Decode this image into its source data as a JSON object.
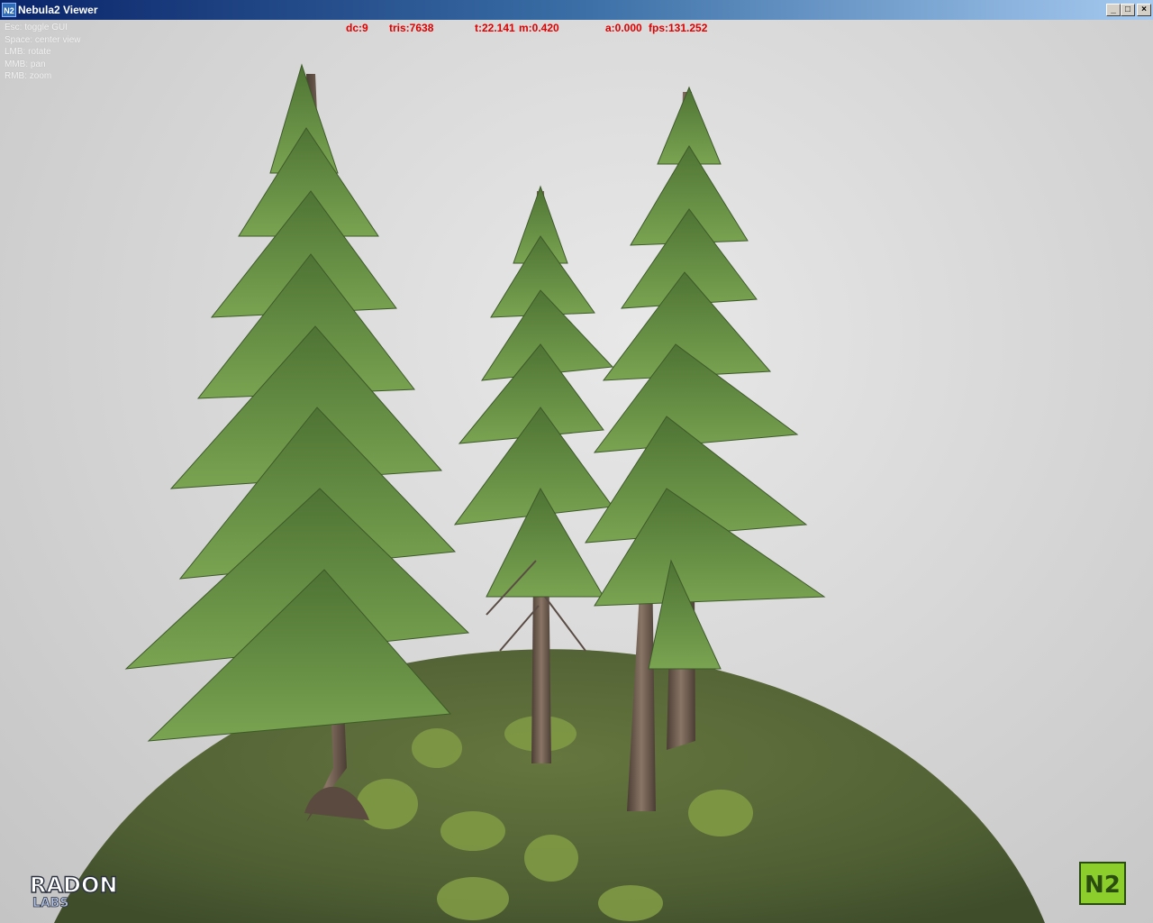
{
  "window": {
    "title": "Nebula2 Viewer",
    "icon": "nebula-app-icon",
    "controls": {
      "minimize": "_",
      "maximize": "□",
      "close": "×"
    }
  },
  "help_overlay": [
    "Esc: toggle GUI",
    "Space: center view",
    "LMB: rotate",
    "MMB: pan",
    "RMB: zoom"
  ],
  "stats": {
    "dc": "dc:9",
    "tris": "tris:7638",
    "time": "t:22.141",
    "m": "m:0.420",
    "a": "a:0.000",
    "fps": "fps:131.252",
    "color": "#e00000"
  },
  "logos": {
    "radon": {
      "line1": "RADON",
      "line2": "LABS"
    },
    "n2": {
      "text": "N2"
    }
  },
  "scene": {
    "background": "#d8d8d8",
    "ground_color": "#5b6b3a",
    "foliage_color": "#5e8a3a",
    "trunk_color": "#6e5a4c"
  }
}
